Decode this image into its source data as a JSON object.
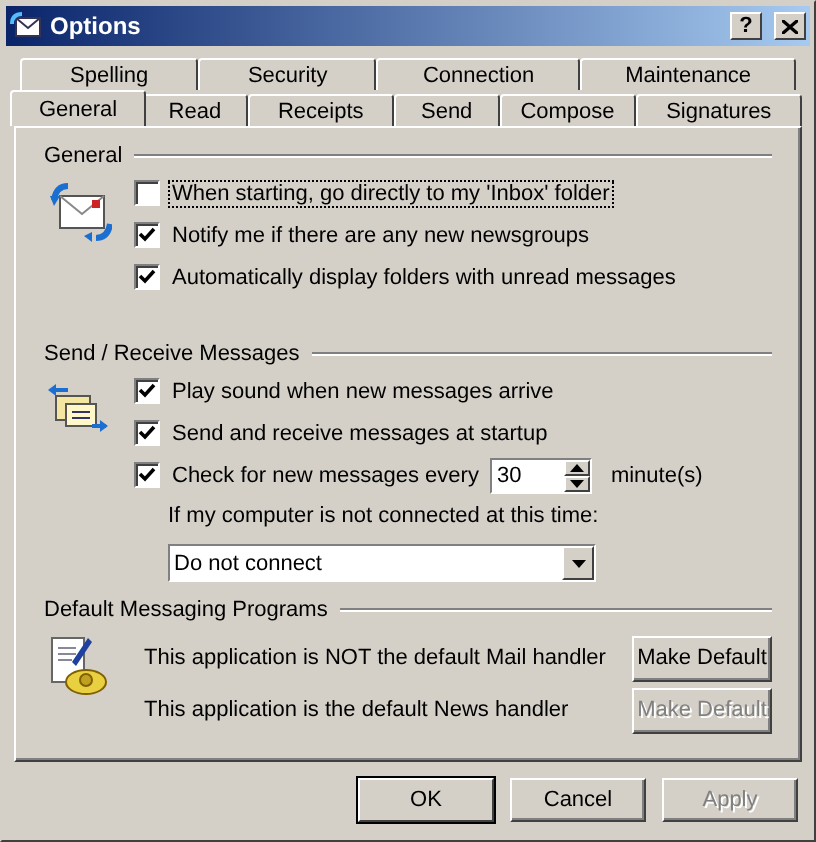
{
  "window": {
    "title": "Options",
    "help": "?"
  },
  "tab_rows": [
    [
      {
        "label": "Spelling",
        "selected": false
      },
      {
        "label": "Security",
        "selected": false
      },
      {
        "label": "Connection",
        "selected": false
      },
      {
        "label": "Maintenance",
        "selected": false
      }
    ],
    [
      {
        "label": "General",
        "selected": true
      },
      {
        "label": "Read",
        "selected": false
      },
      {
        "label": "Receipts",
        "selected": false
      },
      {
        "label": "Send",
        "selected": false
      },
      {
        "label": "Compose",
        "selected": false
      },
      {
        "label": "Signatures",
        "selected": false
      }
    ]
  ],
  "general": {
    "heading": "General",
    "options": [
      {
        "label": "When starting, go directly to my 'Inbox' folder",
        "checked": false,
        "focused": true
      },
      {
        "label": "Notify me if there are any new newsgroups",
        "checked": true,
        "focused": false
      },
      {
        "label": "Automatically display folders with unread messages",
        "checked": true,
        "focused": false
      }
    ]
  },
  "send_receive": {
    "heading": "Send / Receive Messages",
    "options": [
      {
        "label": "Play sound when new messages arrive",
        "checked": true,
        "focused": false
      },
      {
        "label": "Send and receive messages at startup",
        "checked": true,
        "focused": false
      },
      {
        "label": "Check for new messages every",
        "checked": true,
        "focused": false,
        "value": "30",
        "unit": "minute(s)"
      }
    ],
    "offline_label": "If my computer is not connected at this time:",
    "offline_choice": "Do not connect"
  },
  "default_programs": {
    "heading": "Default Messaging Programs",
    "handlers": [
      {
        "text": "This application is NOT the default Mail handler",
        "button": "Make Default",
        "disabled": false
      },
      {
        "text": "This application is the default News handler",
        "button": "Make Default",
        "disabled": true
      }
    ]
  },
  "buttons": [
    {
      "label": "OK",
      "default": true,
      "disabled": false
    },
    {
      "label": "Cancel",
      "default": false,
      "disabled": false
    },
    {
      "label": "Apply",
      "default": false,
      "disabled": true
    }
  ]
}
